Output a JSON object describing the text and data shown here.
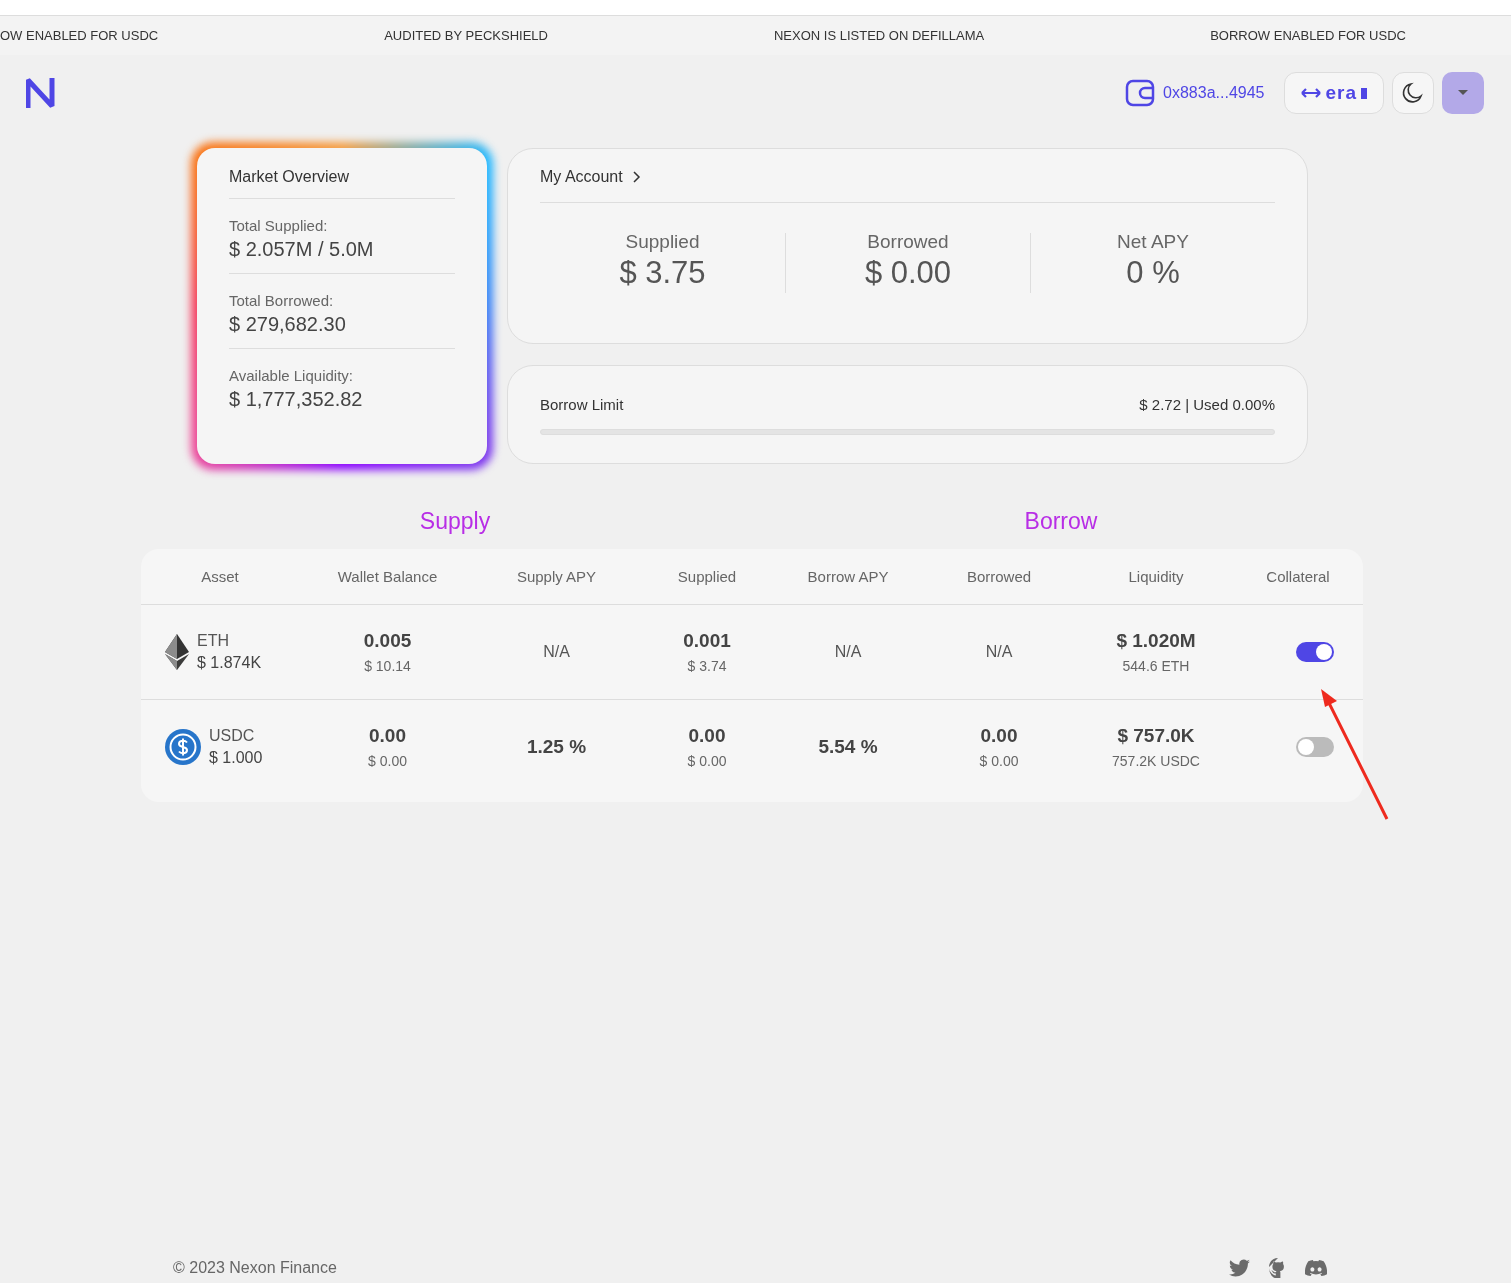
{
  "ticker": [
    "OW ENABLED FOR USDC",
    "AUDITED BY PECKSHIELD",
    "NEXON IS LISTED ON DEFILLAMA",
    "BORROW ENABLED FOR USDC"
  ],
  "header": {
    "wallet": "0x883a...4945",
    "network": "era"
  },
  "market_overview": {
    "title": "Market Overview",
    "stats": [
      {
        "label": "Total Supplied:",
        "value": "$ 2.057M / 5.0M"
      },
      {
        "label": "Total Borrowed:",
        "value": "$ 279,682.30"
      },
      {
        "label": "Available Liquidity:",
        "value": "$ 1,777,352.82"
      }
    ]
  },
  "my_account": {
    "title": "My Account",
    "stats": [
      {
        "label": "Supplied",
        "value": "$ 3.75"
      },
      {
        "label": "Borrowed",
        "value": "$ 0.00"
      },
      {
        "label": "Net APY",
        "value": "0 %"
      }
    ]
  },
  "borrow_limit": {
    "label": "Borrow Limit",
    "reading": "$ 2.72 | Used 0.00%"
  },
  "section_titles": [
    "Supply",
    "Borrow"
  ],
  "table": {
    "columns": [
      "Asset",
      "Wallet Balance",
      "Supply APY",
      "Supplied",
      "Borrow APY",
      "Borrowed",
      "Liquidity",
      "Collateral"
    ],
    "rows": [
      {
        "kind": "eth",
        "asset": "ETH",
        "price": "$ 1.874K",
        "wallet_balance": {
          "main": "0.005",
          "sub": "$ 10.14"
        },
        "supply_apy": {
          "main": "N/A"
        },
        "supplied": {
          "main": "0.001",
          "sub": "$ 3.74"
        },
        "borrow_apy": {
          "main": "N/A"
        },
        "borrowed": {
          "main": "N/A"
        },
        "liquidity": {
          "main": "$ 1.020M",
          "sub": "544.6 ETH"
        },
        "collateral": true
      },
      {
        "kind": "usdc",
        "asset": "USDC",
        "price": "$ 1.000",
        "wallet_balance": {
          "main": "0.00",
          "sub": "$ 0.00"
        },
        "supply_apy": {
          "main": "1.25 %"
        },
        "supplied": {
          "main": "0.00",
          "sub": "$ 0.00"
        },
        "borrow_apy": {
          "main": "5.54 %"
        },
        "borrowed": {
          "main": "0.00",
          "sub": "$ 0.00"
        },
        "liquidity": {
          "main": "$ 757.0K",
          "sub": "757.2K USDC"
        },
        "collateral": false
      }
    ]
  },
  "footer": {
    "copyright": "© 2023 Nexon Finance"
  }
}
